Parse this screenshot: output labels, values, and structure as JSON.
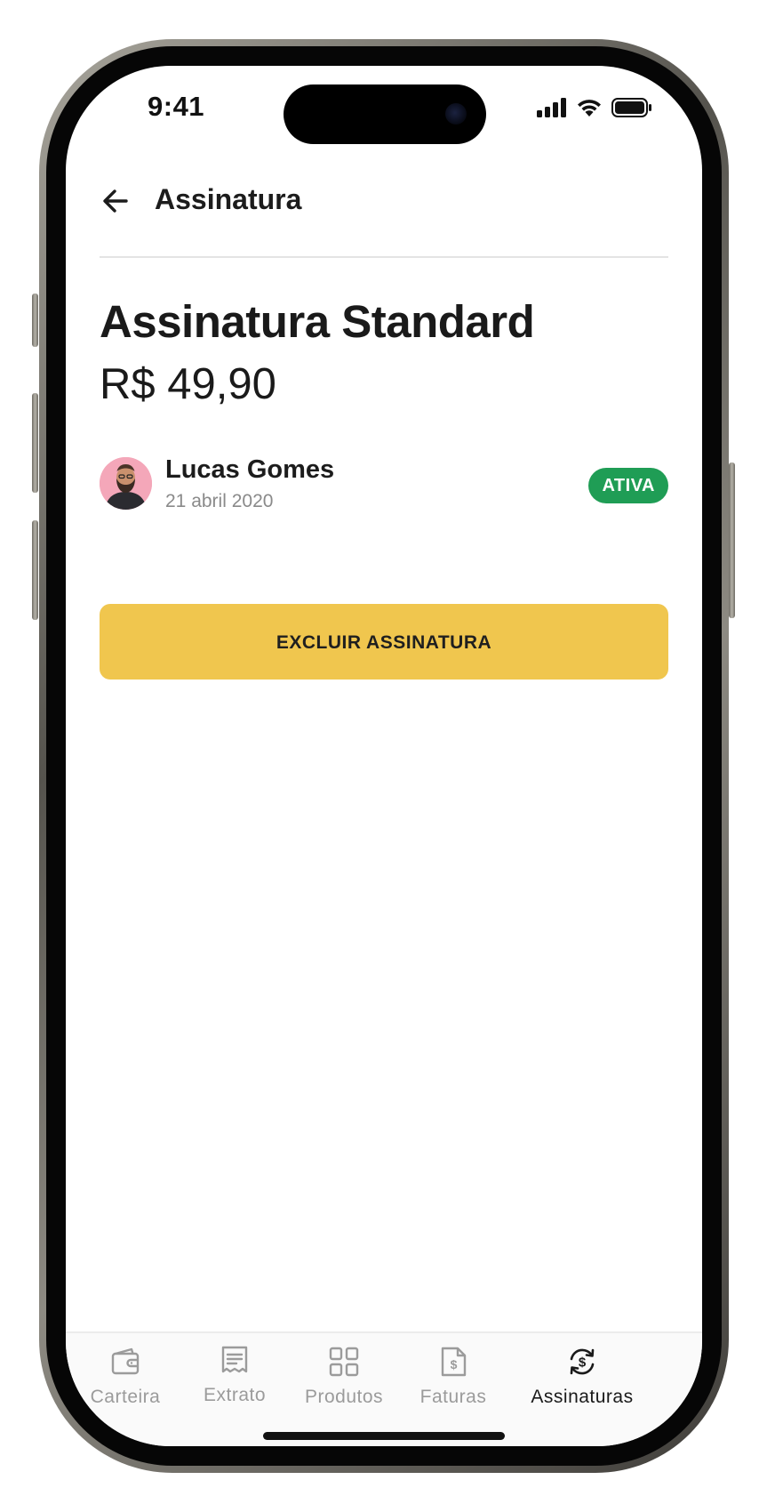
{
  "status_bar": {
    "time": "9:41"
  },
  "header": {
    "back_icon": "arrow-left-icon",
    "title": "Assinatura"
  },
  "subscription": {
    "plan_name": "Assinatura Standard",
    "price": "R$ 49,90",
    "subscriber_name": "Lucas Gomes",
    "date": "21 abril 2020",
    "status": "ATIVA"
  },
  "actions": {
    "delete_label": "EXCLUIR ASSINATURA"
  },
  "tabbar": {
    "items": [
      {
        "label": "Carteira",
        "icon": "wallet-icon",
        "active": false
      },
      {
        "label": "Extrato",
        "icon": "receipt-icon",
        "active": false
      },
      {
        "label": "Produtos",
        "icon": "grid-icon",
        "active": false
      },
      {
        "label": "Faturas",
        "icon": "invoice-icon",
        "active": false
      },
      {
        "label": "Assinaturas",
        "icon": "subscription-cycle-icon",
        "active": true
      }
    ]
  },
  "colors": {
    "accent_yellow": "#f0c64e",
    "status_green": "#1f9d55",
    "text_primary": "#1a1a1a",
    "text_muted": "#8a8a8a",
    "tab_inactive": "#9b9b9b"
  }
}
